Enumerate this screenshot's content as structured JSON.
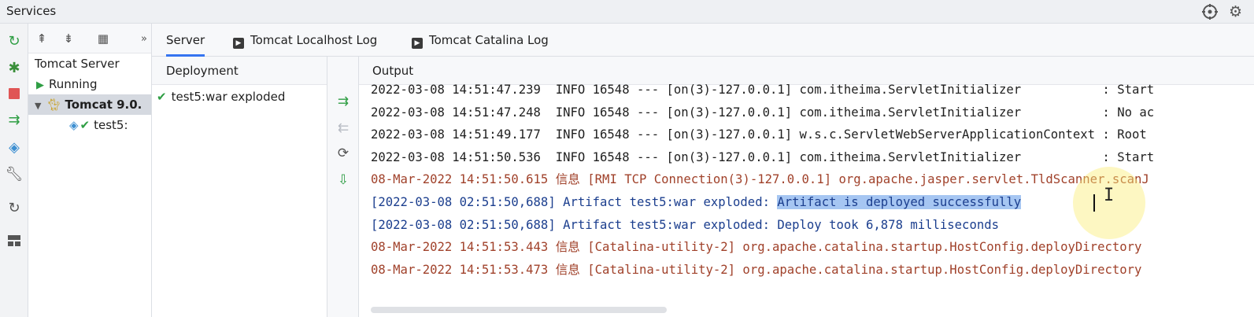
{
  "window": {
    "title": "Services"
  },
  "titlebar_icons": [
    "crosshair-icon",
    "gear-icon"
  ],
  "leftbar": {
    "icons": [
      "rerun-icon",
      "debug-icon",
      "stop-icon",
      "deploy-icon",
      "artifact-icon",
      "wrench-icon",
      "refresh-icon",
      "layout-icon"
    ]
  },
  "tree": {
    "toolbar_icons": [
      "expand-all-icon",
      "collapse-all-icon",
      "group-by-icon",
      "more-icon"
    ],
    "items": [
      {
        "label": "Tomcat Server",
        "level": 0
      },
      {
        "label": "Running",
        "level": 1
      },
      {
        "label": "Tomcat 9.0.",
        "level": 1,
        "selected": true
      },
      {
        "label": "test5:",
        "level": 2
      }
    ]
  },
  "tabs": [
    {
      "label": "Server",
      "active": true
    },
    {
      "label": "Tomcat Localhost Log",
      "active": false
    },
    {
      "label": "Tomcat Catalina Log",
      "active": false
    }
  ],
  "deployment": {
    "header": "Deployment",
    "items": [
      {
        "label": "test5:war exploded",
        "status": "ok"
      }
    ]
  },
  "output": {
    "header": "Output",
    "lines": [
      {
        "kind": "info",
        "text": "2022-03-08 14:51:47.239  INFO 16548 --- [on(3)-127.0.0.1] com.itheima.ServletInitializer           : Start"
      },
      {
        "kind": "info",
        "text": "2022-03-08 14:51:47.248  INFO 16548 --- [on(3)-127.0.0.1] com.itheima.ServletInitializer           : No ac"
      },
      {
        "kind": "info",
        "text": "2022-03-08 14:51:49.177  INFO 16548 --- [on(3)-127.0.0.1] w.s.c.ServletWebServerApplicationContext : Root"
      },
      {
        "kind": "info",
        "text": "2022-03-08 14:51:50.536  INFO 16548 --- [on(3)-127.0.0.1] com.itheima.ServletInitializer           : Start"
      },
      {
        "kind": "cat",
        "text": "08-Mar-2022 14:51:50.615 信息 [RMI TCP Connection(3)-127.0.0.1] org.apache.jasper.servlet.TldScanner.scanJ"
      },
      {
        "kind": "art",
        "prefix": "[2022-03-08 02:51:50,688] Artifact test5:war exploded: ",
        "highlight": "Artifact is deployed successfully"
      },
      {
        "kind": "art",
        "text": "[2022-03-08 02:51:50,688] Artifact test5:war exploded: Deploy took 6,878 milliseconds"
      },
      {
        "kind": "cat",
        "text": "08-Mar-2022 14:51:53.443 信息 [Catalina-utility-2] org.apache.catalina.startup.HostConfig.deployDirectory"
      },
      {
        "kind": "cat",
        "text": "08-Mar-2022 14:51:53.473 信息 [Catalina-utility-2] org.apache.catalina.startup.HostConfig.deployDirectory"
      }
    ]
  },
  "colors": {
    "accent": "#3574f0",
    "run_green": "#2f9e44",
    "stop_red": "#e05555",
    "catalina_text": "#a0412a",
    "artifact_text": "#1b3e8e",
    "selection": "#a6c6f2"
  }
}
